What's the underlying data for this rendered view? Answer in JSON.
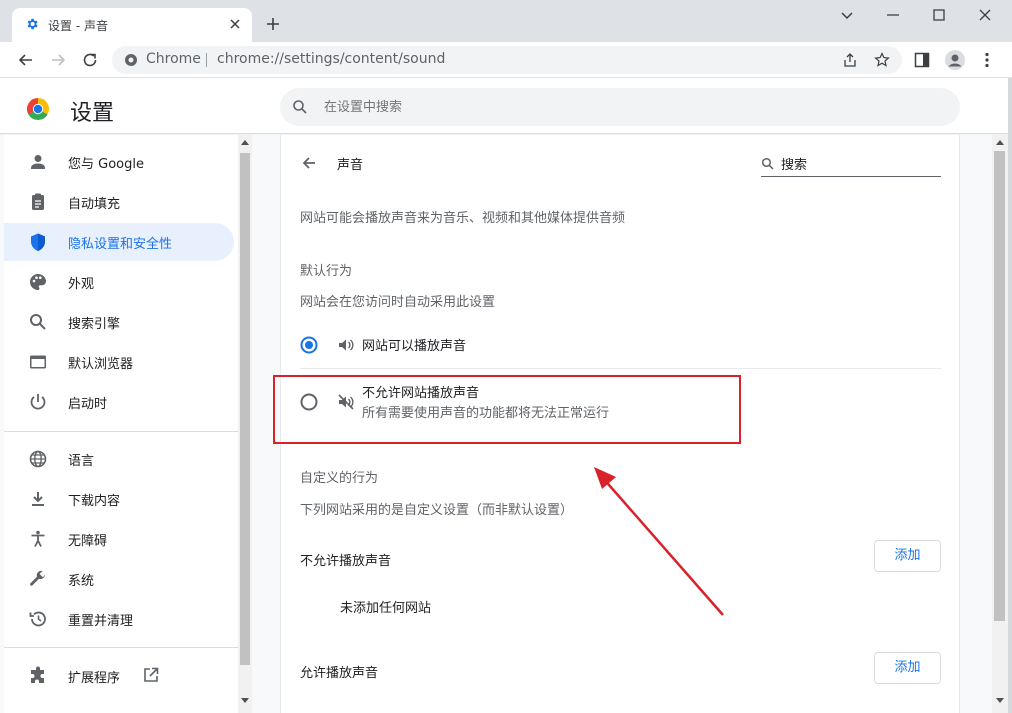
{
  "tab": {
    "title": "设置 - 声音"
  },
  "omnibox": {
    "site_label": "Chrome",
    "url": "chrome://settings/content/sound"
  },
  "header": {
    "title": "设置",
    "search_placeholder": "在设置中搜索"
  },
  "sidebar": {
    "items": [
      {
        "label": "您与 Google",
        "icon": "person-icon"
      },
      {
        "label": "自动填充",
        "icon": "clipboard-icon"
      },
      {
        "label": "隐私设置和安全性",
        "icon": "shield-icon",
        "active": true
      },
      {
        "label": "外观",
        "icon": "palette-icon"
      },
      {
        "label": "搜索引擎",
        "icon": "search-icon"
      },
      {
        "label": "默认浏览器",
        "icon": "browser-icon"
      },
      {
        "label": "启动时",
        "icon": "power-icon"
      },
      {
        "label": "语言",
        "icon": "globe-icon"
      },
      {
        "label": "下载内容",
        "icon": "download-icon"
      },
      {
        "label": "无障碍",
        "icon": "accessibility-icon"
      },
      {
        "label": "系统",
        "icon": "wrench-icon"
      },
      {
        "label": "重置并清理",
        "icon": "history-icon"
      },
      {
        "label": "扩展程序",
        "icon": "puzzle-icon"
      }
    ]
  },
  "page": {
    "title": "声音",
    "search_label": "搜索",
    "description": "网站可能会播放声音来为音乐、视频和其他媒体提供音频",
    "default_heading": "默认行为",
    "default_sub": "网站会在您访问时自动采用此设置",
    "options": [
      {
        "label": "网站可以播放声音",
        "selected": true,
        "icon": "volume-icon"
      },
      {
        "label": "不允许网站播放声音",
        "sublabel": "所有需要使用声音的功能都将无法正常运行",
        "selected": false,
        "icon": "volume-off-icon"
      }
    ],
    "custom_heading": "自定义的行为",
    "custom_sub": "下列网站采用的是自定义设置（而非默认设置）",
    "block_heading": "不允许播放声音",
    "block_empty": "未添加任何网站",
    "allow_heading": "允许播放声音",
    "add_label": "添加"
  },
  "colors": {
    "accent": "#1a73e8",
    "annotation": "#d9212c"
  }
}
